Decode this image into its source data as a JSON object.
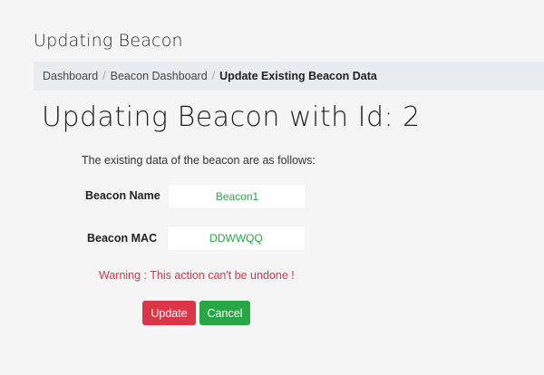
{
  "header": {
    "title": "Updating Beacon"
  },
  "breadcrumb": {
    "items": [
      "Dashboard",
      "Beacon Dashboard"
    ],
    "active": "Update Existing Beacon Data"
  },
  "main": {
    "title": "Updating Beacon with Id: 2",
    "intro": "The existing data of the beacon are as follows:",
    "fields": {
      "name_label": "Beacon Name",
      "name_value": "Beacon1",
      "mac_label": "Beacon MAC",
      "mac_value": "DDWWQQ"
    },
    "warning": "Warning : This action can't be undone !",
    "buttons": {
      "update_label": "Update",
      "cancel_label": "Cancel"
    }
  },
  "colors": {
    "danger": "#dc3545",
    "success": "#28a745",
    "breadcrumb_bg": "#e9ecef"
  }
}
